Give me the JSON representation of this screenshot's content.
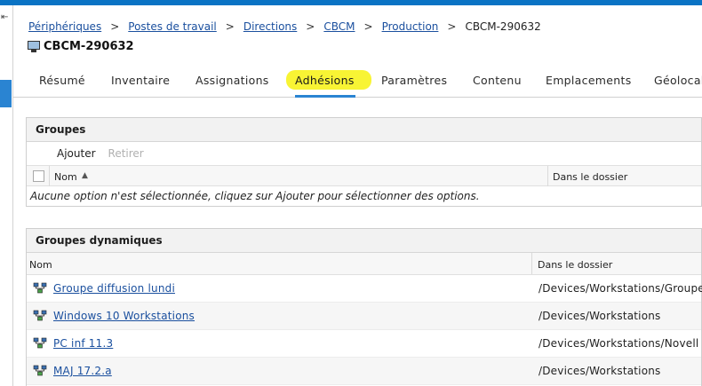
{
  "breadcrumb": {
    "items": [
      "Périphériques",
      "Postes de travail",
      "Directions",
      "CBCM",
      "Production"
    ],
    "current": "CBCM-290632",
    "separator": ">"
  },
  "device": {
    "title": "CBCM-290632"
  },
  "tabs": [
    "Résumé",
    "Inventaire",
    "Assignations",
    "Adhésions",
    "Paramètres",
    "Contenu",
    "Emplacements",
    "Géolocal"
  ],
  "active_tab": "Adhésions",
  "groups_panel": {
    "title": "Groupes",
    "add_label": "Ajouter",
    "remove_label": "Retirer",
    "col_name": "Nom",
    "col_folder": "Dans le dossier",
    "empty_message": "Aucune option n'est sélectionnée, cliquez sur Ajouter pour sélectionner des options."
  },
  "dynamic_panel": {
    "title": "Groupes dynamiques",
    "col_name": "Nom",
    "col_folder": "Dans le dossier",
    "rows": [
      {
        "name": "Groupe diffusion lundi",
        "folder": "/Devices/Workstations/Groupe"
      },
      {
        "name": "Windows 10 Workstations",
        "folder": "/Devices/Workstations"
      },
      {
        "name": "PC inf 11.3",
        "folder": "/Devices/Workstations/Novell"
      },
      {
        "name": "MAJ 17.2.a",
        "folder": "/Devices/Workstations"
      }
    ]
  },
  "colors": {
    "accent": "#2a84d2",
    "topbar": "#0a73c4",
    "highlight": "#f7f211",
    "link": "#1a4f9e"
  }
}
